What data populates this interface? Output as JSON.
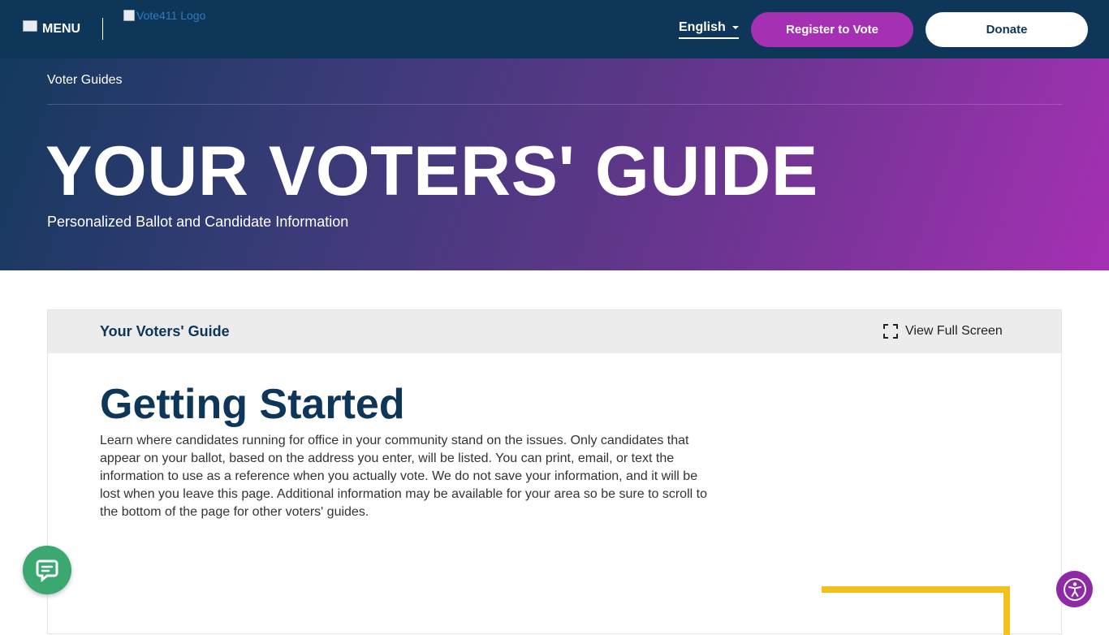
{
  "nav": {
    "menu_label": "MENU",
    "logo_alt": "Vote411 Logo",
    "language": "English",
    "register_label": "Register to Vote",
    "donate_label": "Donate"
  },
  "hero": {
    "breadcrumb": "Voter Guides",
    "title": "YOUR VOTERS' GUIDE",
    "subtitle": "Personalized Ballot and Candidate Information"
  },
  "guide": {
    "panel_title": "Your Voters' Guide",
    "fullscreen_label": "View Full Screen",
    "heading": "Getting Started",
    "intro": "Learn where candidates running for office in your community stand on the issues. Only candidates that appear on your ballot, based on the address you enter, will be listed. You can print, email, or text the information to use as a reference when you actually vote. We do not save your information, and it will be lost when you leave this page. Additional information may be available for your area so be sure to scroll to the bottom of the page for other voters' guides."
  },
  "icons": {
    "menu": "broken-image-icon",
    "fullscreen": "expand-icon",
    "chat": "chat-icon",
    "accessibility": "accessibility-icon"
  },
  "colors": {
    "navy": "#0d3658",
    "purple": "#a630b4",
    "chat_green": "#3aa870",
    "accent_yellow": "#f3c11b"
  }
}
